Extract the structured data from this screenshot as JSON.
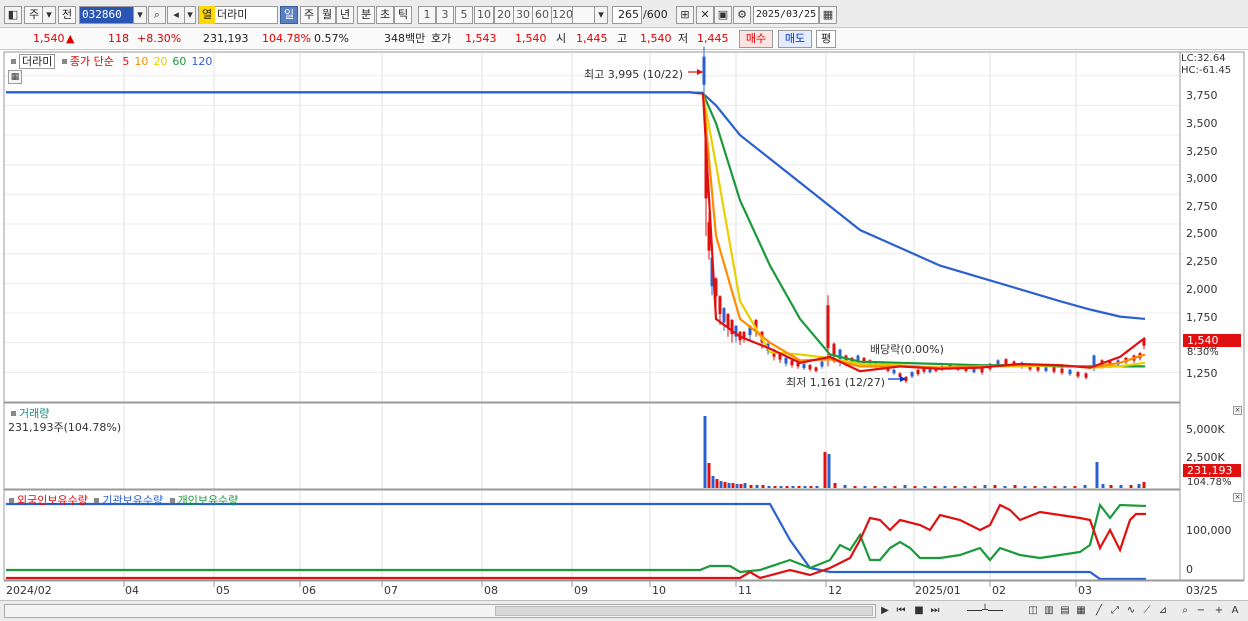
{
  "toolbar": {
    "market": "주",
    "prev": "전",
    "code": "032860",
    "name_tag": "열",
    "name": "더라미",
    "periods": [
      "일",
      "주",
      "월",
      "년",
      "분",
      "초",
      "틱"
    ],
    "active_period": "일",
    "intervals": [
      "1",
      "3",
      "5",
      "10",
      "20",
      "30",
      "60",
      "120"
    ],
    "count": "265",
    "count_max": "/600",
    "date": "2025/03/25"
  },
  "quote": {
    "price": "1,540",
    "up_arrow": "▲",
    "change": "118",
    "change_pct": "+8.30%",
    "volume": "231,193",
    "volume_ratio": "104.78%",
    "turnover": "0.57%",
    "amount": "348백만",
    "hoga_label": "호가",
    "hoga_ask": "1,543",
    "hoga_bid": "1,540",
    "open_label": "시",
    "open": "1,445",
    "high_label": "고",
    "high": "1,540",
    "low_label": "저",
    "low": "1,445",
    "buy": "매수",
    "sell": "매도",
    "eval": "평"
  },
  "legend": {
    "stock": "더라미",
    "close": "종가",
    "simple": "단순",
    "ma": [
      "5",
      "10",
      "20",
      "60",
      "120"
    ],
    "ma_colors": [
      "#e01010",
      "#ff8c00",
      "#e8d000",
      "#1a9a3a",
      "#2a60d0"
    ]
  },
  "lc": "LC:32.64",
  "hc": "HC:-61.45",
  "annotations": {
    "high": "최고 3,995 (10/22)",
    "low": "최저 1,161 (12/27)",
    "dividend": "배당락(0.00%)"
  },
  "price_tag": {
    "value": "1,540",
    "pct": "8.30%"
  },
  "volume_panel": {
    "title": "거래량",
    "value": "231,193주(104.78%)",
    "tag_value": "231,193",
    "tag_pct": "104.78%",
    "ticks": [
      "5,000K",
      "2,500K",
      "0"
    ]
  },
  "holdings_panel": {
    "series": [
      "외국인보유수량",
      "기관보유수량",
      "개인보유수량"
    ],
    "colors": [
      "#e01010",
      "#2a60d0",
      "#1a9a3a"
    ],
    "ticks": [
      "100,000",
      "0"
    ]
  },
  "price_ticks": [
    "3,750",
    "3,500",
    "3,250",
    "3,000",
    "2,750",
    "2,500",
    "2,250",
    "2,000",
    "1,750",
    "1,500",
    "1,250"
  ],
  "x_ticks": [
    "2024/02",
    "04",
    "05",
    "06",
    "07",
    "08",
    "09",
    "10",
    "11",
    "12",
    "2025/01",
    "02",
    "03",
    "03/25"
  ],
  "chart_data": {
    "type": "line",
    "y_price_range": [
      1000,
      3950
    ],
    "annotations": {
      "high": {
        "date": "10/22",
        "value": 3995
      },
      "low": {
        "date": "12/27",
        "value": 1161
      }
    },
    "series": [
      {
        "name": "5",
        "values": [
          3610,
          3610,
          3610,
          3610,
          3610,
          3610,
          3610,
          3610,
          3600,
          1700,
          1550,
          1450,
          1330,
          1380,
          1260,
          1300,
          1280,
          1290,
          1320,
          1310,
          1290,
          1380,
          1540
        ]
      },
      {
        "name": "10",
        "values": [
          3610,
          3610,
          3610,
          3610,
          3610,
          3610,
          3610,
          3610,
          3600,
          2400,
          1700,
          1500,
          1350,
          1360,
          1300,
          1300,
          1290,
          1300,
          1310,
          1310,
          1290,
          1330,
          1400
        ]
      },
      {
        "name": "20",
        "values": [
          3610,
          3610,
          3610,
          3610,
          3610,
          3610,
          3610,
          3610,
          3600,
          3000,
          1850,
          1420,
          1400,
          1370,
          1320,
          1310,
          1290,
          1300,
          1300,
          1310,
          1290,
          1300,
          1330
        ]
      },
      {
        "name": "60",
        "values": [
          3610,
          3610,
          3610,
          3610,
          3610,
          3610,
          3610,
          3610,
          3600,
          3350,
          2700,
          2150,
          1700,
          1400,
          1340,
          1330,
          1320,
          1310,
          1310,
          1300,
          1300,
          1300,
          1300
        ]
      },
      {
        "name": "120",
        "values": [
          3610,
          3610,
          3610,
          3610,
          3610,
          3610,
          3610,
          3610,
          3600,
          3500,
          3250,
          3050,
          2850,
          2650,
          2450,
          2300,
          2150,
          2050,
          1950,
          1850,
          1780,
          1720,
          1700
        ]
      }
    ]
  }
}
